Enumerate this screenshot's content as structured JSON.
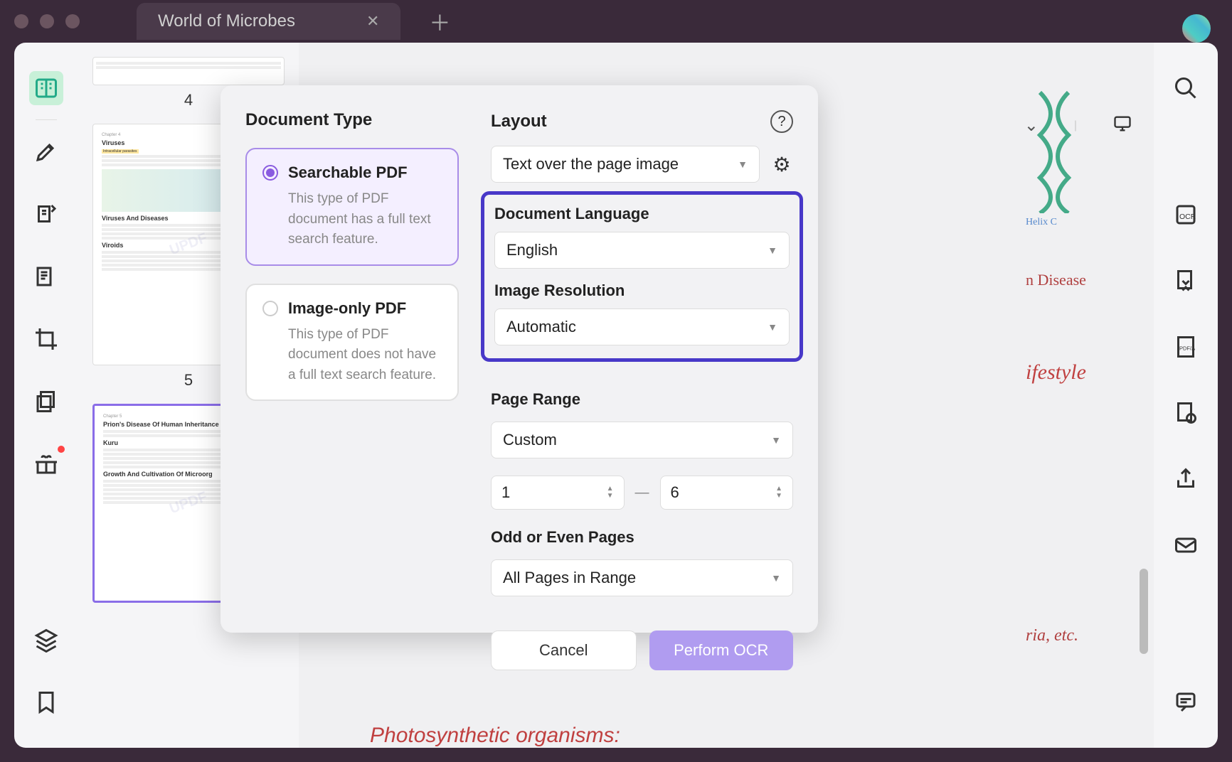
{
  "tab": {
    "title": "World of Microbes"
  },
  "thumbnails": {
    "page4_label": "4",
    "page5_label": "5",
    "page5_headings": {
      "viruses": "Viruses",
      "viruses_diseases": "Viruses And Diseases",
      "viroids": "Viroids"
    },
    "page6_headings": {
      "prion": "Prion's Disease Of Human Inheritance",
      "kuru": "Kuru",
      "growth": "Growth And Cultivation Of Microorg"
    }
  },
  "doc": {
    "helix_c": "Helix C",
    "disease": "n Disease",
    "lifestyle": "ifestyle",
    "etc": "ria, etc.",
    "photo": "Photosynthetic organisms:"
  },
  "dialog": {
    "doc_type_heading": "Document Type",
    "searchable_pdf": {
      "title": "Searchable PDF",
      "desc": "This type of PDF document has a full text search feature."
    },
    "image_only_pdf": {
      "title": "Image-only PDF",
      "desc": "This type of PDF document does not have a full text search feature."
    },
    "layout_heading": "Layout",
    "layout_value": "Text over the page image",
    "lang_heading": "Document Language",
    "lang_value": "English",
    "resolution_heading": "Image Resolution",
    "resolution_value": "Automatic",
    "page_range_heading": "Page Range",
    "page_range_value": "Custom",
    "page_from": "1",
    "page_to": "6",
    "odd_even_heading": "Odd or Even Pages",
    "odd_even_value": "All Pages in Range",
    "cancel": "Cancel",
    "perform": "Perform OCR"
  }
}
